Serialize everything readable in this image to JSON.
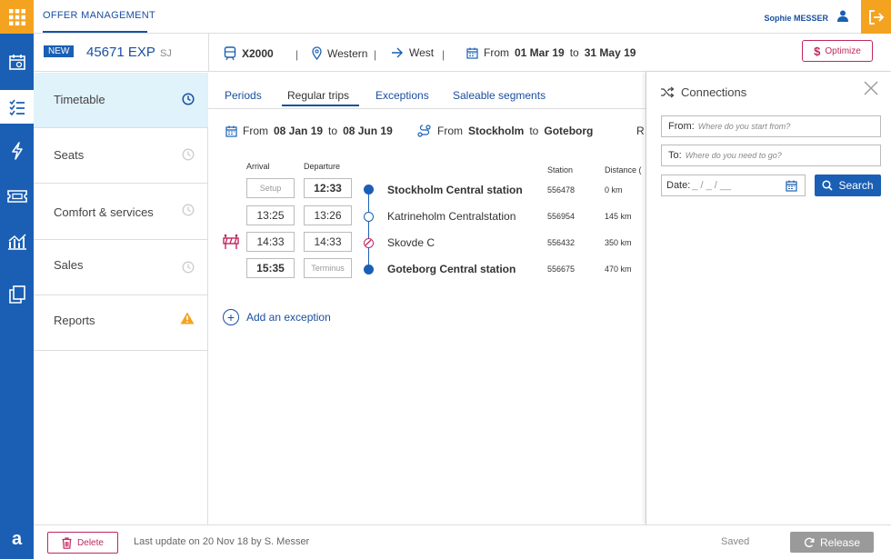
{
  "app": {
    "title": "OFFER MANAGEMENT",
    "user": "Sophie MESSER"
  },
  "offer": {
    "badge": "NEW",
    "id": "45671 EXP",
    "operator": "SJ",
    "train_type": "X2000",
    "region": "Western",
    "direction": "West",
    "period_prefix": "From",
    "period_from": "01 Mar 19",
    "period_to_word": "to",
    "period_to": "31 May 19",
    "optimize_label": "Optimize"
  },
  "nav": [
    {
      "label": "Timetable",
      "icon": "clock-icon",
      "active": true
    },
    {
      "label": "Seats",
      "icon": "clock-icon"
    },
    {
      "label": "Comfort & services",
      "icon": "clock-icon"
    },
    {
      "label": "Sales",
      "icon": "clock-icon"
    },
    {
      "label": "Reports",
      "icon": "warning-icon"
    }
  ],
  "tabs": [
    "Periods",
    "Regular trips",
    "Exceptions",
    "Saleable segments"
  ],
  "active_tab": "Regular trips",
  "trip": {
    "from_word": "From",
    "date_from": "08 Jan 19",
    "to_word": "to",
    "date_to": "08 Jun 19",
    "route_from_word": "From",
    "origin": "Stockholm",
    "route_to_word": "to",
    "destination": "Goteborg",
    "route_suffix": "R"
  },
  "columns": {
    "arrival": "Arrival",
    "departure": "Departure",
    "station": "Station",
    "distance": "Distance ("
  },
  "stops": [
    {
      "arrival": "Setup",
      "departure": "12:33",
      "name": "Stockholm Central station",
      "code": "556478",
      "distance": "0 km"
    },
    {
      "arrival": "13:25",
      "departure": "13:26",
      "name": "Katrineholm Centralstation",
      "code": "556954",
      "distance": "145 km"
    },
    {
      "arrival": "14:33",
      "departure": "14:33",
      "name": "Skovde C",
      "code": "556432",
      "distance": "350 km"
    },
    {
      "arrival": "15:35",
      "departure": "Terminus",
      "name": "Goteborg Central station",
      "code": "556675",
      "distance": "470 km"
    }
  ],
  "add_exception_label": "Add an exception",
  "connections": {
    "title": "Connections",
    "from_label": "From:",
    "from_placeholder": "Where do you start from?",
    "to_label": "To:",
    "to_placeholder": "Where do you need to go?",
    "date_label": "Date:",
    "date_placeholder": "_ / _ / __",
    "search_label": "Search"
  },
  "footer": {
    "delete_label": "Delete",
    "last_update": "Last update on 20 Nov 18 by S. Messer",
    "saved": "Saved",
    "release_label": "Release"
  },
  "colors": {
    "brand_blue": "#1a5fb4",
    "accent_orange": "#f4a320",
    "danger": "#c0275f",
    "active_nav": "#e0f2fa"
  }
}
